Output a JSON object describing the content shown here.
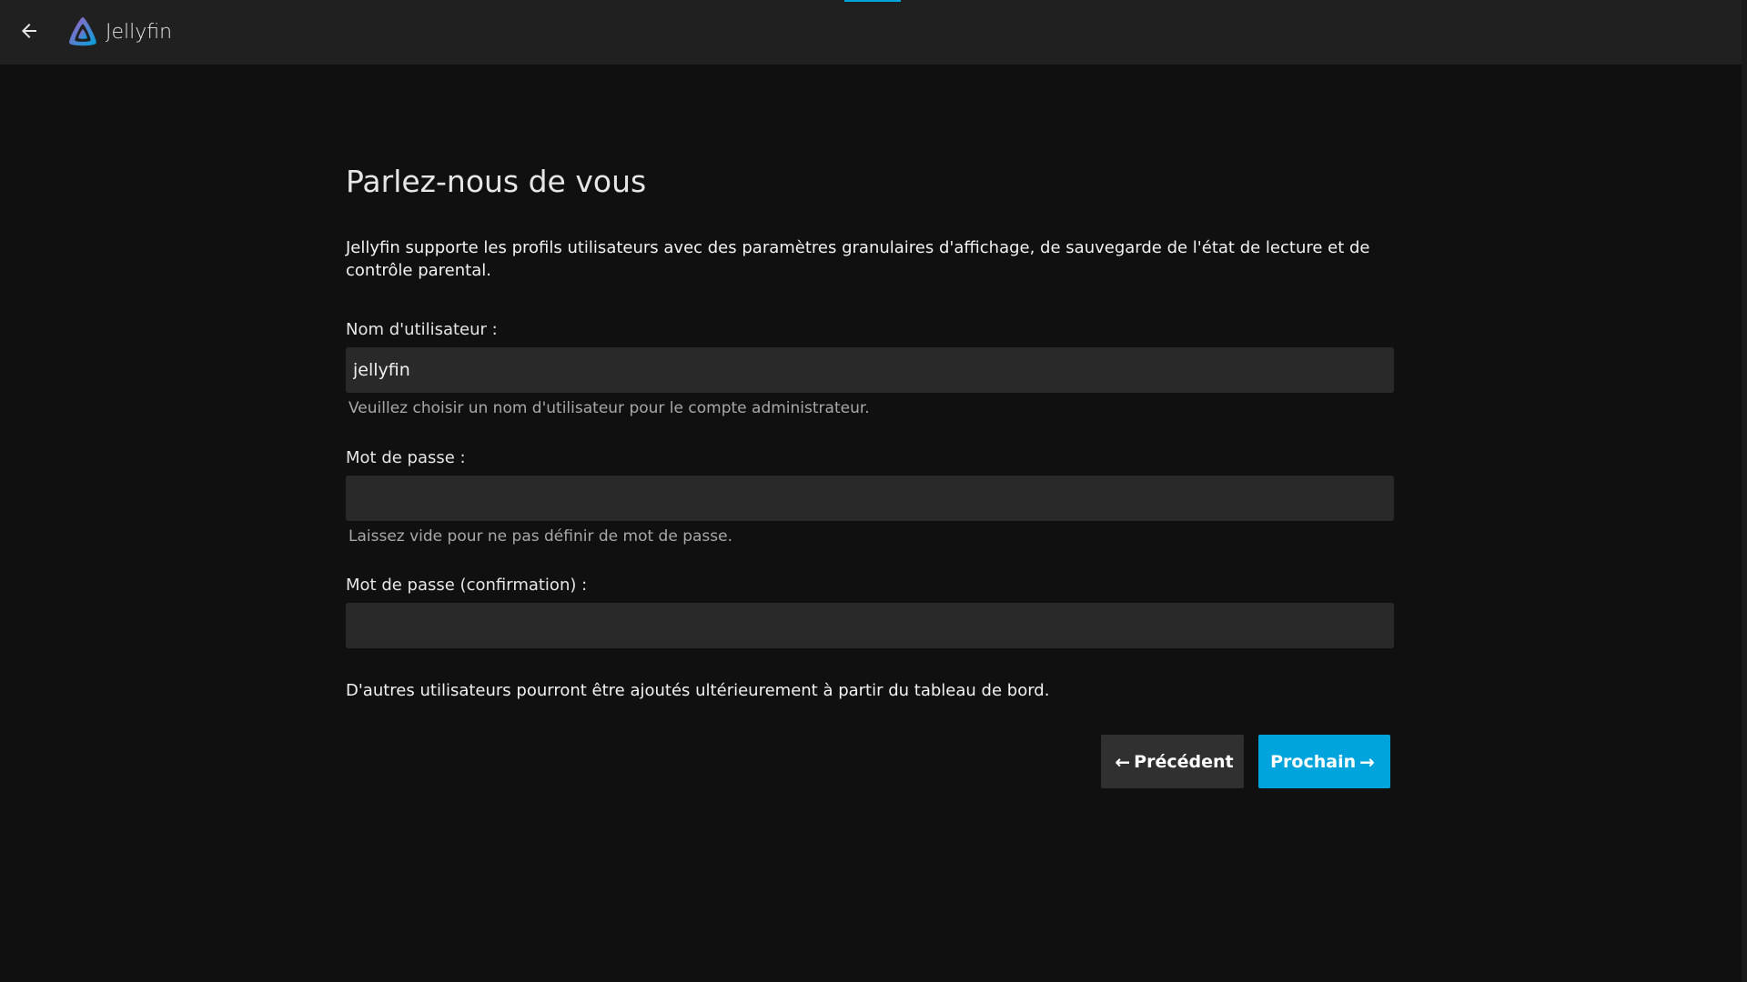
{
  "header": {
    "back_icon": "arrow-left-icon",
    "brand_name": "Jellyfin",
    "logo_icon": "jellyfin-logo-icon"
  },
  "colors": {
    "accent": "#00a4dc",
    "background": "#101010",
    "header_bg": "#202020",
    "input_bg": "#292929"
  },
  "page": {
    "title": "Parlez-nous de vous",
    "intro": "Jellyfin supporte les profils utilisateurs avec des paramètres granulaires d'affichage, de sauvegarde de l'état de lecture et de contrôle parental."
  },
  "form": {
    "username": {
      "label": "Nom d'utilisateur :",
      "value": "jellyfin",
      "hint": "Veuillez choisir un nom d'utilisateur pour le compte administrateur."
    },
    "password": {
      "label": "Mot de passe :",
      "value": "",
      "hint": "Laissez vide pour ne pas définir de mot de passe."
    },
    "password_confirm": {
      "label": "Mot de passe (confirmation) :",
      "value": ""
    },
    "footnote": "D'autres utilisateurs pourront être ajoutés ultérieurement à partir du tableau de bord."
  },
  "actions": {
    "previous_label": "Précédent",
    "next_label": "Prochain",
    "previous_icon": "arrow-left-icon",
    "next_icon": "arrow-right-icon"
  }
}
